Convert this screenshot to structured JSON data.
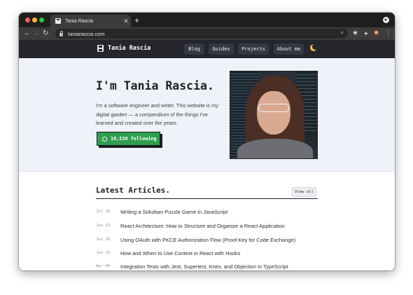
{
  "browser": {
    "tab_title": "Tania Rascia",
    "tab_close": "✕",
    "new_tab": "+",
    "url": "taniarascia.com",
    "back": "←",
    "forward": "→",
    "reload": "↻",
    "zoom_icon": "⌕",
    "star_icon": "★",
    "extensions_icon": "✦",
    "menu_icon": "⋮"
  },
  "site_nav": {
    "brand": "Tania Rascia",
    "links": [
      "Blog",
      "Guides",
      "Projects",
      "About me"
    ]
  },
  "hero": {
    "title": "I'm Tania Rascia.",
    "description": "I'm a software engineer and writer. This website is my digital garden — a compendium of the things I've learned and created over the years.",
    "github_button": "10,530 following"
  },
  "articles": {
    "heading": "Latest Articles.",
    "view_all": "View all",
    "items": [
      {
        "date": "Jul 26",
        "title": "Writing a Sokoban Puzzle Game in JavaScript"
      },
      {
        "date": "Jun 23",
        "title": "React Architecture: How to Structure and Organize a React Application"
      },
      {
        "date": "Jun 20",
        "title": "Using OAuth with PKCE Authorization Flow (Proof Key for Code Exchange)"
      },
      {
        "date": "Jun 15",
        "title": "How and When to Use Context in React with Hooks"
      },
      {
        "date": "Apr 06",
        "title": "Integration Tests with Jest, Supertest, Knex, and Objection in TypeScript"
      }
    ]
  },
  "colors": {
    "nav_bg": "#24262b",
    "hero_bg": "#eff2f8",
    "github_green": "#2e9e4f",
    "moon": "#f2c14e"
  }
}
